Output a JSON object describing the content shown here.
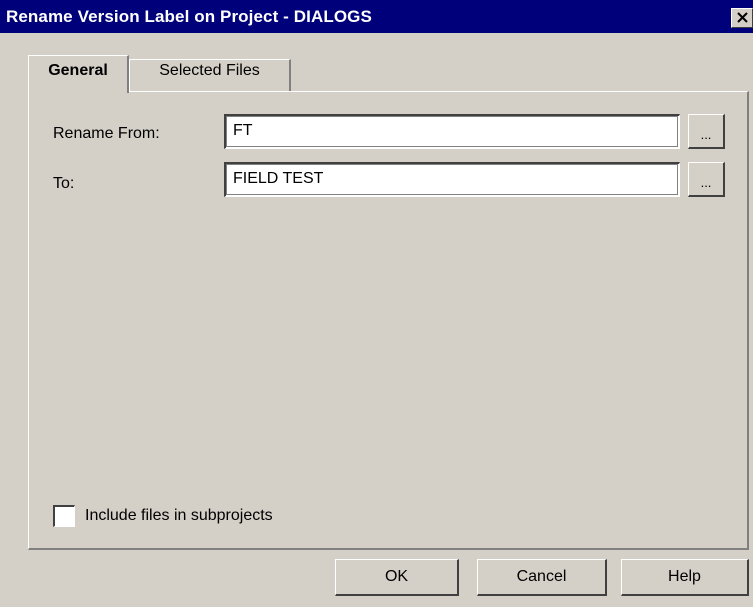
{
  "window": {
    "title": "Rename Version Label on Project - DIALOGS",
    "close_icon": "close-icon"
  },
  "tabs": [
    {
      "label": "General",
      "active": true
    },
    {
      "label": "Selected Files",
      "active": false
    }
  ],
  "form": {
    "rename_from_label": "Rename From:",
    "rename_from_value": "FT",
    "to_label": "To:",
    "to_value": "FIELD TEST",
    "browse_label": "..."
  },
  "options": {
    "include_subprojects_label": "Include files in subprojects",
    "include_subprojects_checked": false
  },
  "buttons": {
    "ok": "OK",
    "cancel": "Cancel",
    "help": "Help"
  },
  "colors": {
    "titlebar": "#00007b",
    "face": "#d4d0c8"
  }
}
